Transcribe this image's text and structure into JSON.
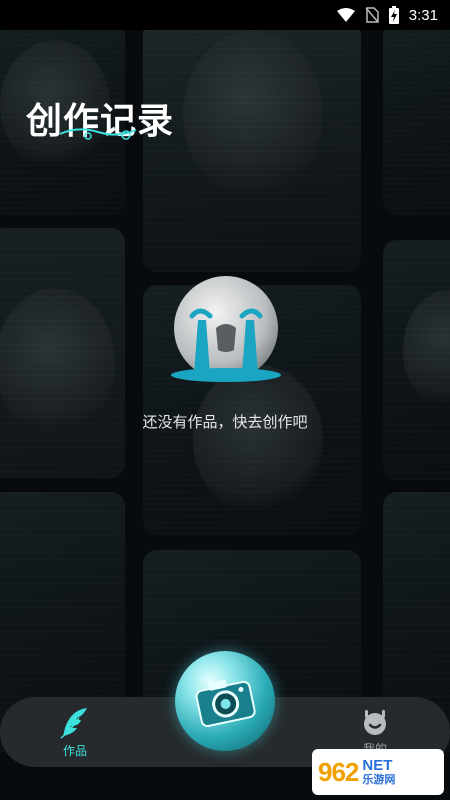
{
  "status_bar": {
    "time": "3:31"
  },
  "header": {
    "title": "创作记录"
  },
  "empty_state": {
    "message": "还没有作品，快去创作吧"
  },
  "bottom_nav": {
    "tabs": [
      {
        "label": "作品",
        "icon": "feather-icon",
        "active": true
      },
      {
        "label": "我的",
        "icon": "profile-icon",
        "active": false
      }
    ],
    "center_action_icon": "camera-icon"
  },
  "watermark": {
    "number": "962",
    "domain": "NET",
    "site": "乐游网"
  },
  "colors": {
    "accent": "#3ce0dc",
    "background": "#0a0d0f",
    "nav_bg": "#262a2c"
  }
}
